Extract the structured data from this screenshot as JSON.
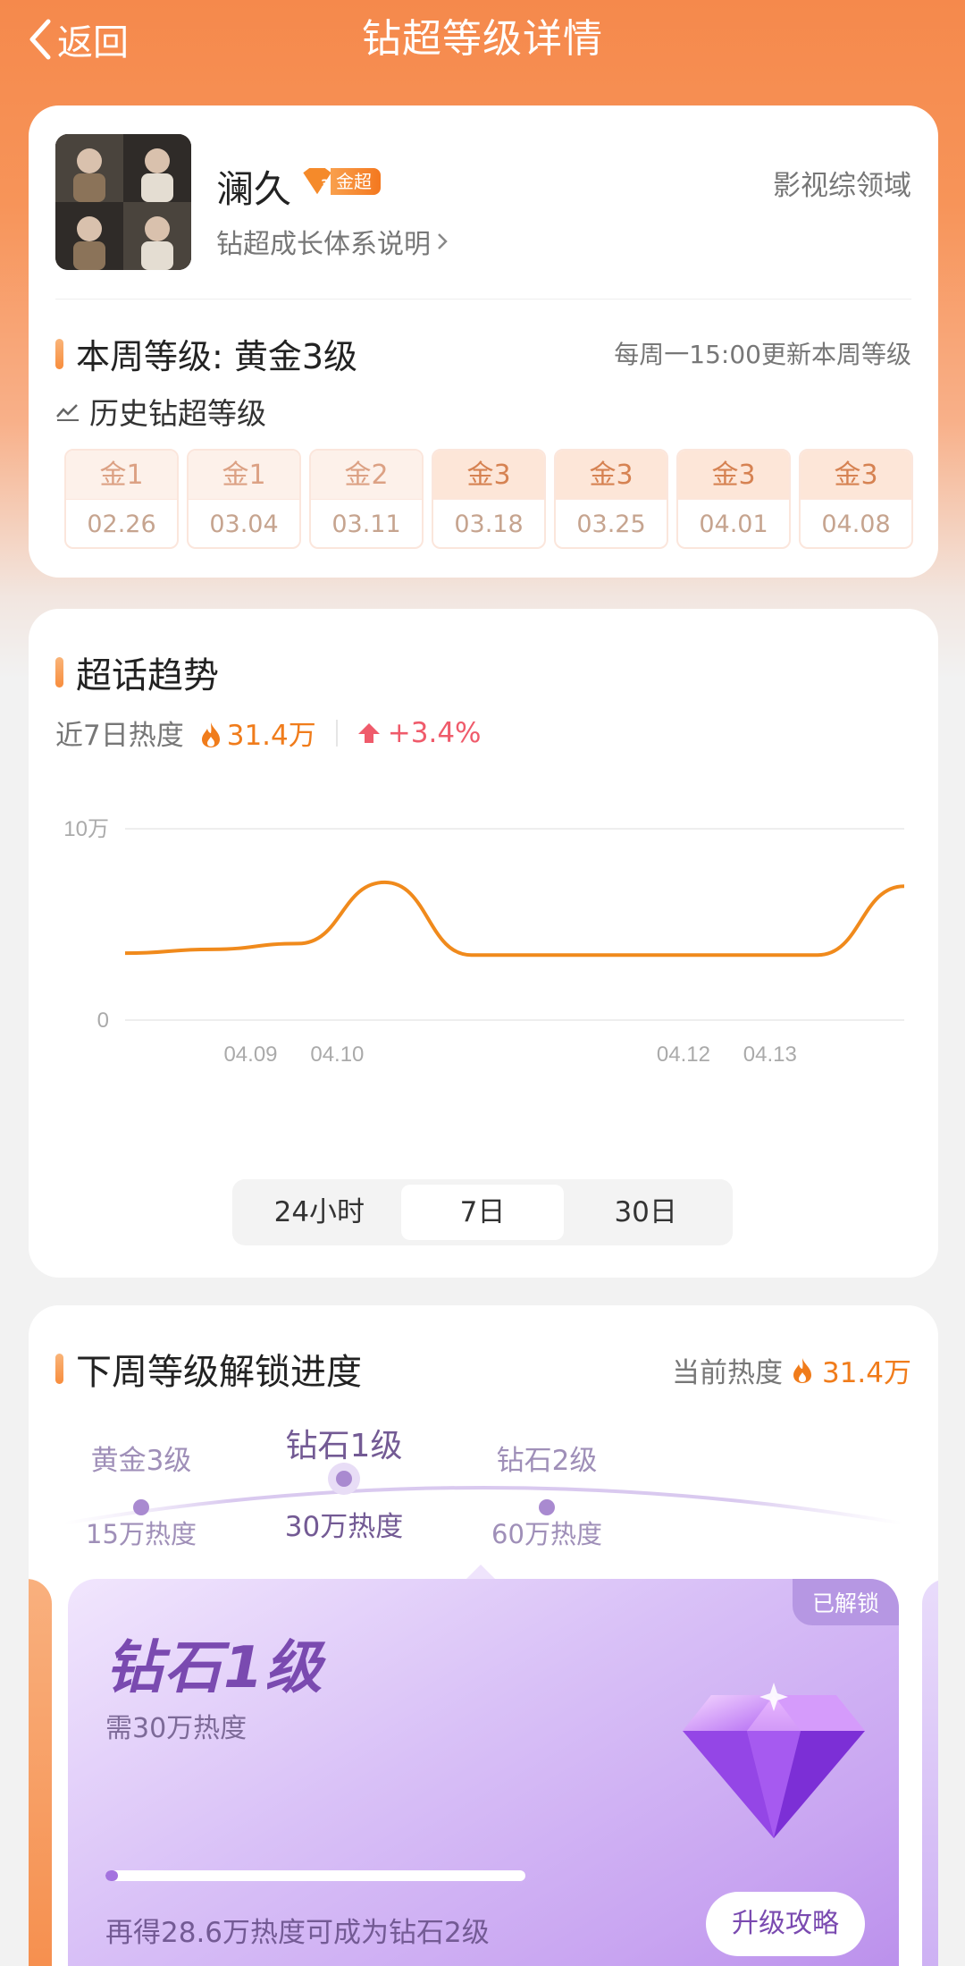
{
  "nav": {
    "back_label": "返回",
    "title": "钻超等级详情"
  },
  "profile": {
    "name": "澜久",
    "badge_level": "3",
    "badge_text": "金超",
    "system_link": "钻超成长体系说明",
    "domain": "影视综领域"
  },
  "week": {
    "label": "本周等级: 黄金3级",
    "update_note": "每周一15:00更新本周等级"
  },
  "history": {
    "title": "历史钻超等级",
    "items": [
      {
        "level": "金1",
        "date": "02.26"
      },
      {
        "level": "金1",
        "date": "03.04"
      },
      {
        "level": "金2",
        "date": "03.11"
      },
      {
        "level": "金3",
        "date": "03.18"
      },
      {
        "level": "金3",
        "date": "03.25"
      },
      {
        "level": "金3",
        "date": "04.01"
      },
      {
        "level": "金3",
        "date": "04.08"
      }
    ]
  },
  "trend": {
    "title": "超话趋势",
    "heat_label": "近7日热度",
    "heat_value": "31.4万",
    "heat_change": "+3.4%",
    "tabs": [
      "24小时",
      "7日",
      "30日"
    ],
    "active_tab": "7日"
  },
  "chart_data": {
    "type": "line",
    "y_ticks": [
      "10万",
      "0"
    ],
    "ylim": [
      0,
      100000
    ],
    "x_tick_labels": [
      "04.09",
      "04.10",
      "04.12",
      "04.13"
    ],
    "series": [
      {
        "values": [
          35000,
          37000,
          40000,
          72000,
          34000,
          34000,
          34000,
          34000,
          34000,
          70000
        ]
      }
    ],
    "line_color": "#f08a1c"
  },
  "progress": {
    "title": "下周等级解锁进度",
    "current_label": "当前热度",
    "current_value": "31.4万",
    "tiers": [
      {
        "name": "黄金3级",
        "heat": "15万热度"
      },
      {
        "name": "钻石1级",
        "heat": "30万热度"
      },
      {
        "name": "钻石2级",
        "heat": "60万热度"
      }
    ],
    "card": {
      "status": "已解锁",
      "name": "钻石1级",
      "requirement": "需30万热度",
      "progress_fraction": 0.03,
      "hint": "再得28.6万热度可成为钻石2级",
      "button": "升级攻略"
    }
  }
}
